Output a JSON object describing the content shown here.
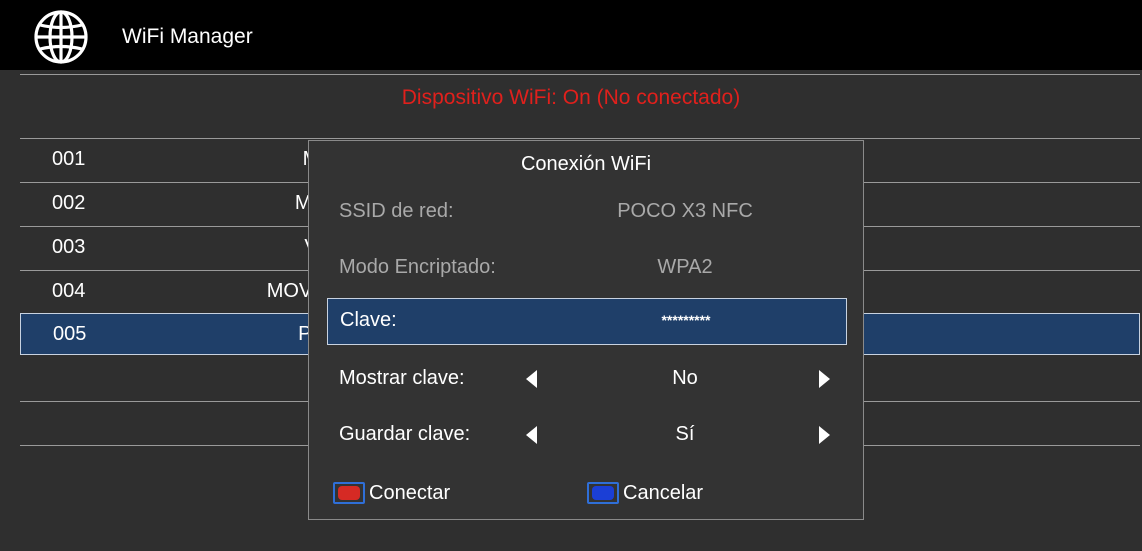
{
  "header": {
    "title": "WiFi Manager",
    "icon": "globe-icon"
  },
  "status": {
    "text": "Dispositivo WiFi: On (No conectado)",
    "color": "#e0201c"
  },
  "networks": [
    {
      "num": "001",
      "name": "M"
    },
    {
      "num": "002",
      "name": "MO"
    },
    {
      "num": "003",
      "name": "V"
    },
    {
      "num": "004",
      "name": "MOVISTA"
    },
    {
      "num": "005",
      "name": "PC"
    }
  ],
  "dialog": {
    "title": "Conexión WiFi",
    "ssid_label": "SSID de red:",
    "ssid_value": "POCO X3 NFC",
    "mode_label": "Modo Encriptado:",
    "mode_value": "WPA2",
    "password_label": "Clave:",
    "password_value": "*********",
    "show_label": "Mostrar clave:",
    "show_value": "No",
    "save_label": "Guardar clave:",
    "save_value": "Sí",
    "connect_label": "Conectar",
    "connect_color": "#d62a24",
    "cancel_label": "Cancelar",
    "cancel_color": "#1b3fd6"
  },
  "colors": {
    "selection": "#1f3f69",
    "background": "#2f2f2f"
  }
}
